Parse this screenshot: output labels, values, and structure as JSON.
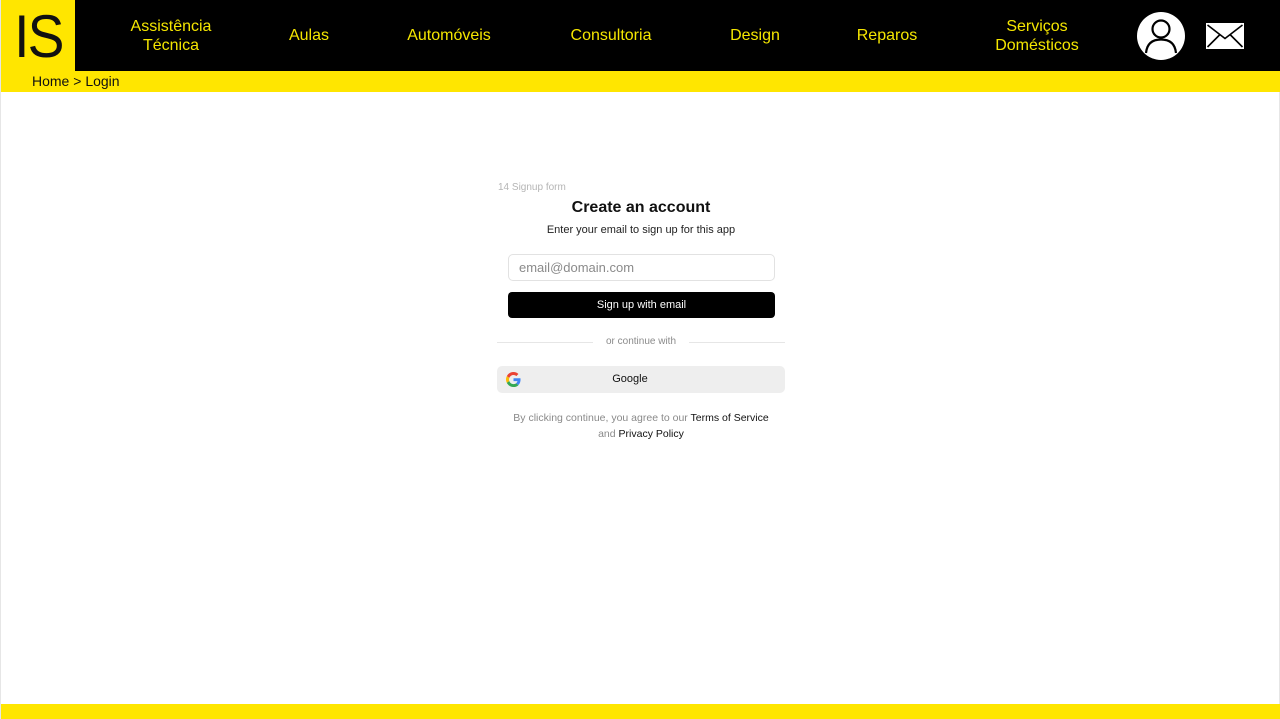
{
  "logo": {
    "text": "IS"
  },
  "nav": {
    "items": [
      {
        "label": "Assistência\nTécnica"
      },
      {
        "label": "Aulas"
      },
      {
        "label": "Automóveis"
      },
      {
        "label": "Consultoria"
      },
      {
        "label": "Design"
      },
      {
        "label": "Reparos"
      },
      {
        "label": "Serviços\nDomésticos"
      }
    ],
    "user_icon": "user-profile-icon",
    "mail_icon": "mail-envelope-icon"
  },
  "breadcrumb": {
    "home": "Home",
    "separator": " > ",
    "current": "Login"
  },
  "form": {
    "tag": "14 Signup form",
    "title": "Create an account",
    "subtitle": "Enter your email to sign up for this app",
    "email_placeholder": "email@domain.com",
    "signup_button": "Sign up with email",
    "divider": "or continue with",
    "google_button": "Google",
    "google_icon": "google-logo-icon",
    "terms_prefix": "By clicking continue, you agree to our ",
    "terms_link": "Terms of Service",
    "terms_and": "and ",
    "privacy_link": "Privacy Policy"
  },
  "colors": {
    "accent": "#ffe600",
    "nav_text": "#f5e600",
    "nav_bg": "#000000",
    "button_bg": "#000000"
  }
}
